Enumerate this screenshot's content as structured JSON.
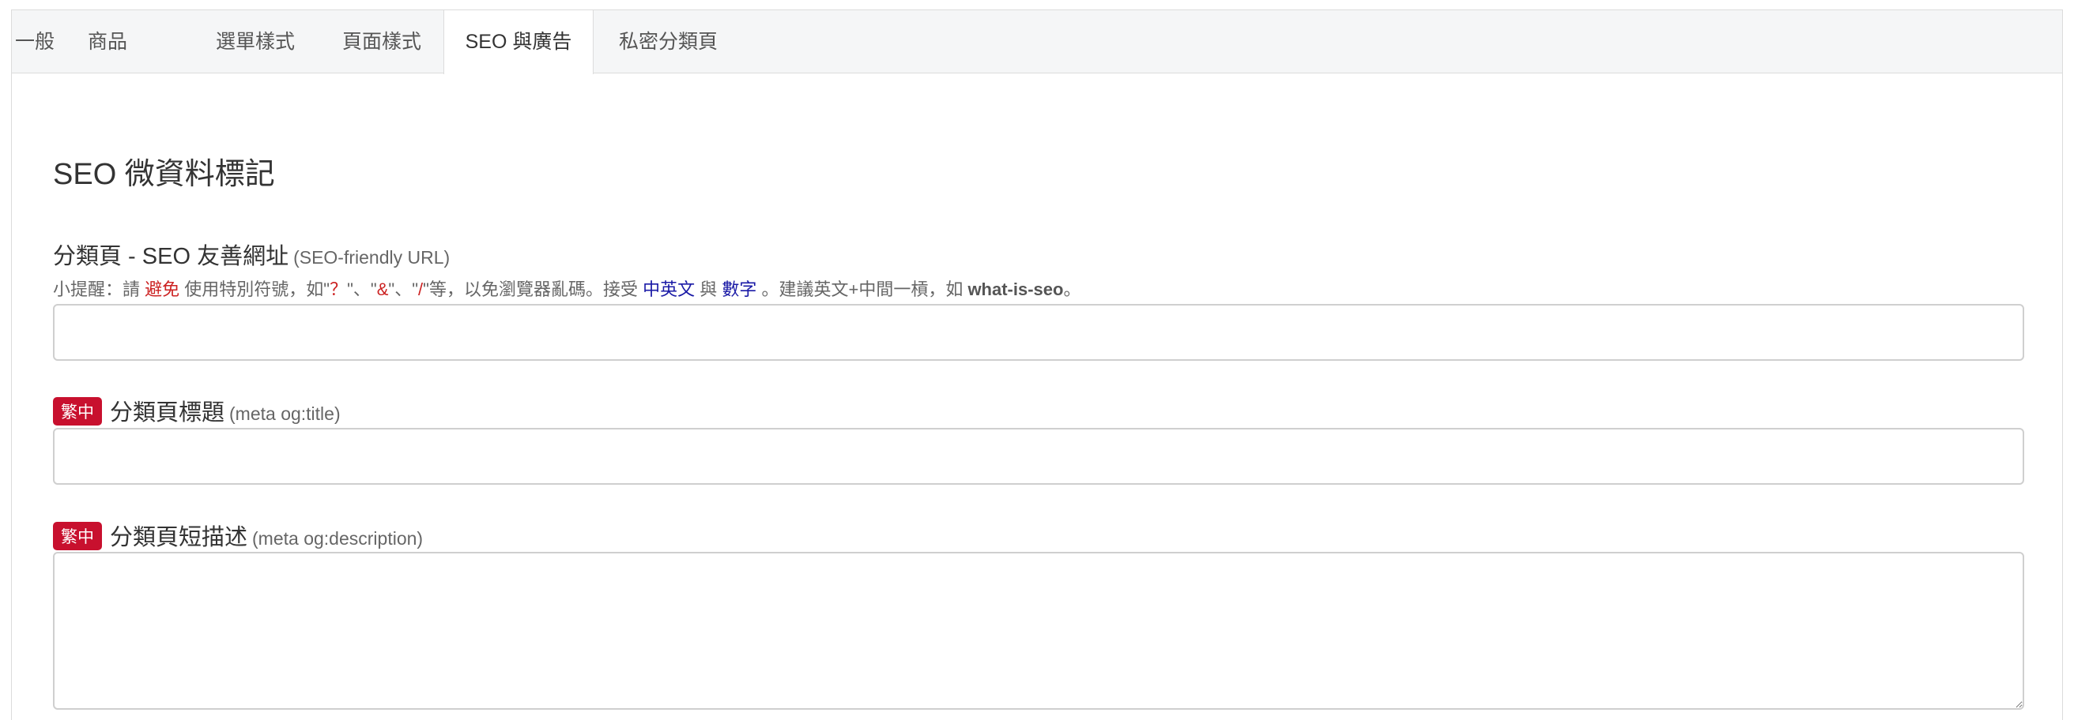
{
  "tabs": [
    {
      "label": "一般"
    },
    {
      "label": "商品"
    },
    {
      "label": "選單樣式"
    },
    {
      "label": "頁面樣式"
    },
    {
      "label": "SEO 與廣告",
      "active": true
    },
    {
      "label": "私密分類頁"
    }
  ],
  "section": {
    "title": "SEO 微資料標記"
  },
  "fields": {
    "slug": {
      "label": "分類頁 - SEO 友善網址",
      "sub": "(SEO-friendly URL)",
      "value": "",
      "hint": {
        "prefix": "小提醒：請 ",
        "avoid": "避免",
        "mid1": " 使用特別符號，如\"",
        "q": "？",
        "mid2": "\"、\"",
        "amp": "&",
        "mid3": "\"、\"",
        "slash": "/",
        "mid4": "\"等，以免瀏覽器亂碼。接受 ",
        "chinese_english": "中英文",
        "and": " 與 ",
        "digits": "數字",
        "mid5": " 。建議英文+中間一槓，如 ",
        "example": "what-is-seo",
        "end": "。"
      }
    },
    "title": {
      "badge": "繁中",
      "label": "分類頁標題",
      "sub": "(meta og:title)",
      "value": ""
    },
    "description": {
      "badge": "繁中",
      "label": "分類頁短描述",
      "sub": "(meta og:description)",
      "value": ""
    }
  }
}
